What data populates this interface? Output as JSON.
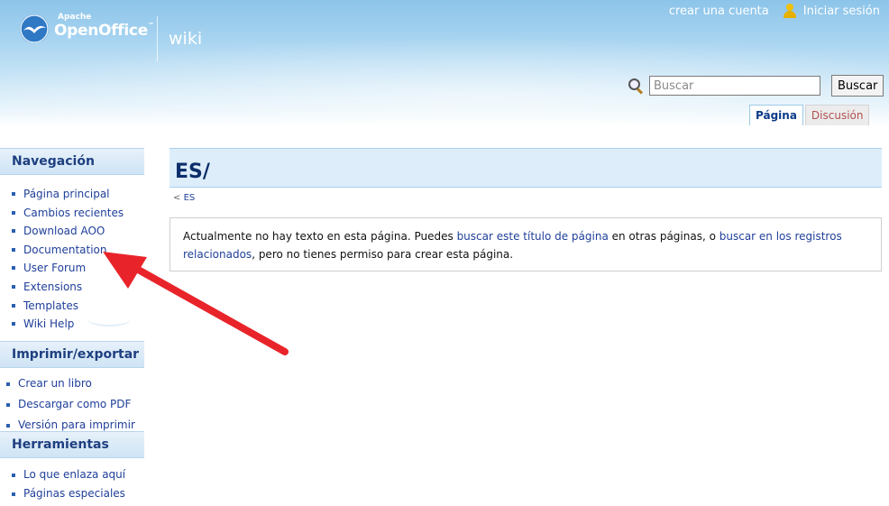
{
  "header": {
    "logo_top": "Apache",
    "logo_main": "OpenOffice",
    "logo_tm": "™",
    "wiki_label": "wiki",
    "create_account": "crear una cuenta",
    "login": "Iniciar sesión"
  },
  "search": {
    "placeholder": "Buscar",
    "button_label": "Buscar"
  },
  "tabs": {
    "page": "Página",
    "talk": "Discusión"
  },
  "sidebar": {
    "navigation": {
      "title": "Navegación",
      "items": [
        "Página principal",
        "Cambios recientes",
        "Download AOO",
        "Documentation",
        "User Forum",
        "Extensions",
        "Templates",
        "Wiki Help"
      ]
    },
    "print": {
      "title": "Imprimir/exportar",
      "items": [
        "Crear un libro",
        "Descargar como PDF",
        "Versión para imprimir"
      ]
    },
    "tools": {
      "title": "Herramientas",
      "items": [
        "Lo que enlaza aquí",
        "Páginas especiales"
      ]
    }
  },
  "content": {
    "title": "ES/",
    "subpage_prefix": "<",
    "subpage_link": "ES",
    "notice_text1": "Actualmente no hay texto en esta página. Puedes ",
    "notice_link1": "buscar este título de página",
    "notice_text2": " en otras páginas, o ",
    "notice_link2": "buscar en los registros relacionados",
    "notice_text3": ", pero no tienes permiso para crear esta página."
  },
  "colors": {
    "annotation_arrow": "#e8242a",
    "link": "#1f3f9a",
    "title": "#0d2e6b"
  }
}
